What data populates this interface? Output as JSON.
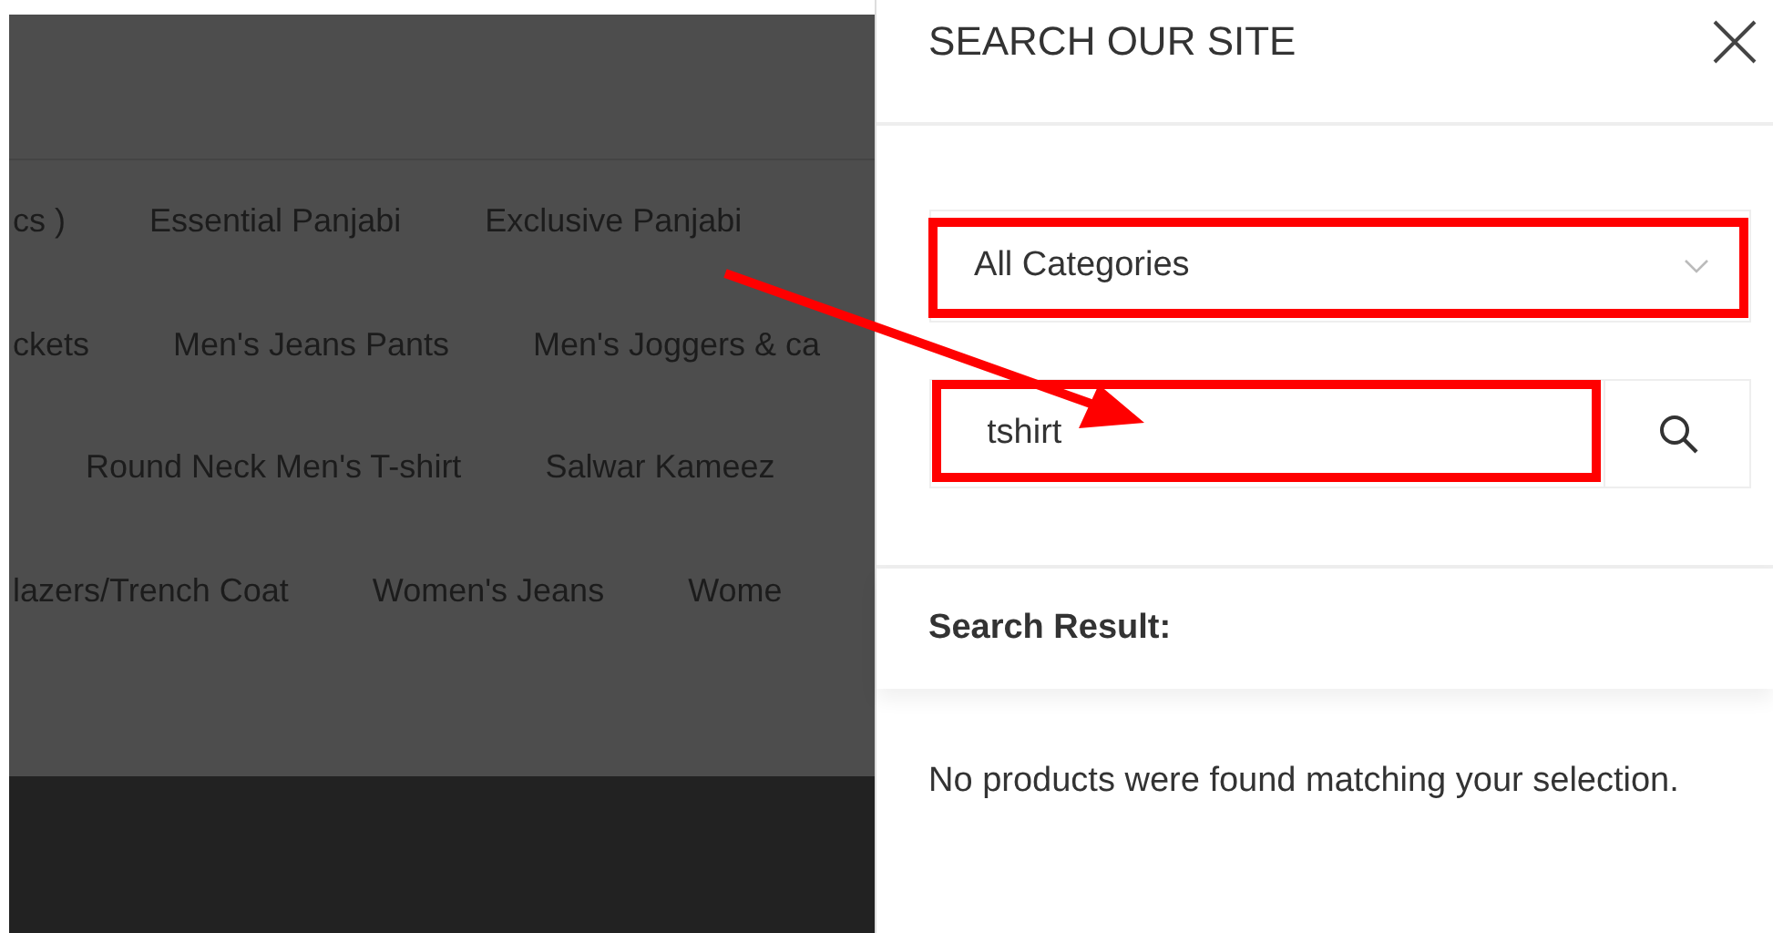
{
  "background_page": {
    "category_rows": [
      [
        "cs )",
        "Essential Panjabi",
        "Exclusive Panjabi"
      ],
      [
        "ckets",
        "Men's Jeans Pants",
        "Men's Joggers & ca"
      ],
      [
        "Round Neck Men's T-shirt",
        "Salwar Kameez"
      ],
      [
        "lazers/Trench Coat",
        "Women's Jeans",
        "Wome"
      ]
    ]
  },
  "search_panel": {
    "title": "SEARCH OUR SITE",
    "category_select": {
      "value": "All Categories"
    },
    "search_field": {
      "value": "tshirt"
    },
    "result_heading": "Search Result:",
    "result_message": "No products were found matching your selection."
  }
}
